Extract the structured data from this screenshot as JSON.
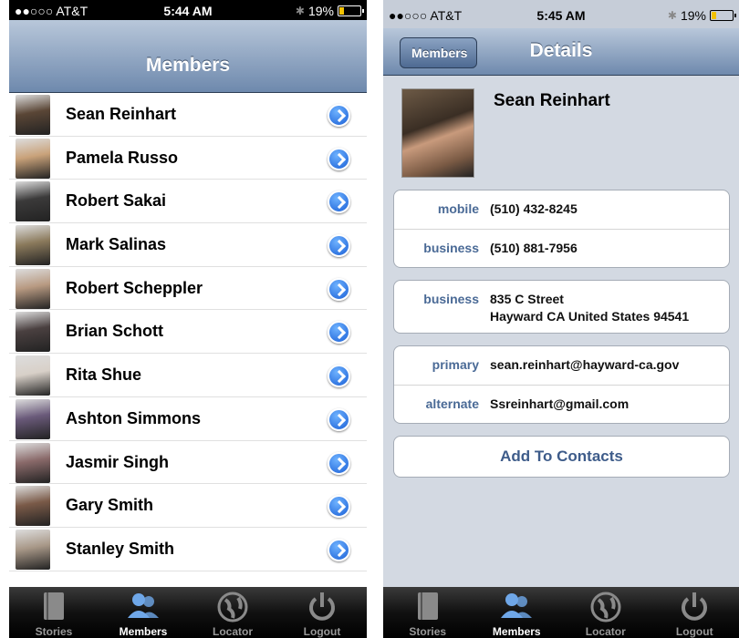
{
  "left": {
    "status": {
      "carrier": "●●○○○ AT&T ",
      "time": "5:44 AM",
      "battery": "19%"
    },
    "title": "Members",
    "members": [
      {
        "name": "Sean Reinhart",
        "color": "#5a4636"
      },
      {
        "name": "Pamela Russo",
        "color": "#c9a27a"
      },
      {
        "name": "Robert Sakai",
        "color": "#3b3a3a"
      },
      {
        "name": "Mark Salinas",
        "color": "#8b7a5c"
      },
      {
        "name": "Robert Scheppler",
        "color": "#b89a82"
      },
      {
        "name": "Brian Schott",
        "color": "#4a4040"
      },
      {
        "name": "Rita Shue",
        "color": "#d8d0c8"
      },
      {
        "name": "Ashton Simmons",
        "color": "#6a5a7a"
      },
      {
        "name": "Jasmir Singh",
        "color": "#8a6a6a"
      },
      {
        "name": "Gary Smith",
        "color": "#7a5a48"
      },
      {
        "name": "Stanley Smith",
        "color": "#a89888"
      }
    ]
  },
  "tabs": [
    {
      "label": "Stories",
      "icon": "book-icon"
    },
    {
      "label": "Members",
      "icon": "people-icon"
    },
    {
      "label": "Locator",
      "icon": "globe-icon"
    },
    {
      "label": "Logout",
      "icon": "power-icon"
    }
  ],
  "right": {
    "status": {
      "carrier": "●●○○○ AT&T ",
      "time": "5:45 AM",
      "battery": "19%"
    },
    "back_label": "Members",
    "title": "Details",
    "name": "Sean Reinhart",
    "phones": [
      {
        "label": "mobile",
        "value": "(510) 432-8245"
      },
      {
        "label": "business",
        "value": "(510) 881-7956"
      }
    ],
    "address": {
      "label": "business",
      "line1": "835 C Street",
      "line2": "Hayward CA United States 94541"
    },
    "emails": [
      {
        "label": "primary",
        "value": "sean.reinhart@hayward-ca.gov"
      },
      {
        "label": "alternate",
        "value": "Ssreinhart@gmail.com"
      }
    ],
    "add_button": "Add To Contacts"
  }
}
